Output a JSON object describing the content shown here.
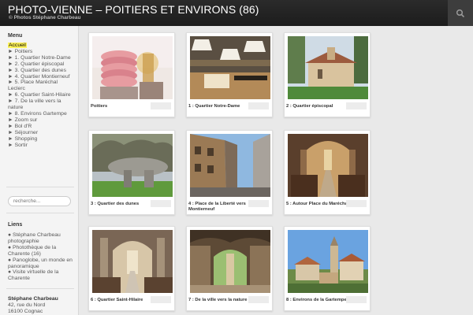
{
  "header": {
    "title": "PHOTO-VIENNE – POITIERS ET ENVIRONS (86)",
    "subtitle": "© Photos Stéphane Charbeau",
    "search_icon": "search-icon"
  },
  "sidebar": {
    "menu_title": "Menu",
    "menu": [
      "Accueil",
      "► Poitiers",
      "► 1. Quartier Notre-Dame",
      "► 2. Quartier épiscopal",
      "► 3. Quartier des dunes",
      "► 4. Quartier Montierneuf",
      "► 5. Place Maréchal Leclerc",
      "► 6. Quartier Saint-Hilaire",
      "► 7. De la ville vers la nature",
      "► 8. Environs Gartempe",
      "► Zoom sur",
      "► Bol d'R",
      "► Séjourner",
      "► Shopping",
      "► Sortir"
    ],
    "search_placeholder": "recherche...",
    "links_title": "Liens",
    "links": [
      "● Stéphane Charbeau photographie",
      "● Photothèque de la Charente (16)",
      "● Panoglobe, un monde en panoramique",
      "● Visite virtuelle de la Charente"
    ],
    "address_name": "Stéphane Charbeau",
    "address_line1": "42, rue du Nord",
    "address_line2": "16100 Cognac"
  },
  "gallery": [
    {
      "caption": "Poitiers"
    },
    {
      "caption": "1 : Quartier Notre-Dame"
    },
    {
      "caption": "2 : Quartier épiscopal"
    },
    {
      "caption": "3 : Quartier des dunes"
    },
    {
      "caption": "4 : Place de la Liberté vers Montierneuf"
    },
    {
      "caption": "5 : Autour Place du Maréchal Leclerc"
    },
    {
      "caption": "6 : Quartier Saint-Hilaire"
    },
    {
      "caption": "7 : De la ville vers la nature"
    },
    {
      "caption": "8 : Environs de la Gartempe"
    }
  ],
  "colors": {
    "header_bg": "#222222",
    "active_highlight": "#fff35a",
    "page_bg": "#e9e9e9"
  }
}
